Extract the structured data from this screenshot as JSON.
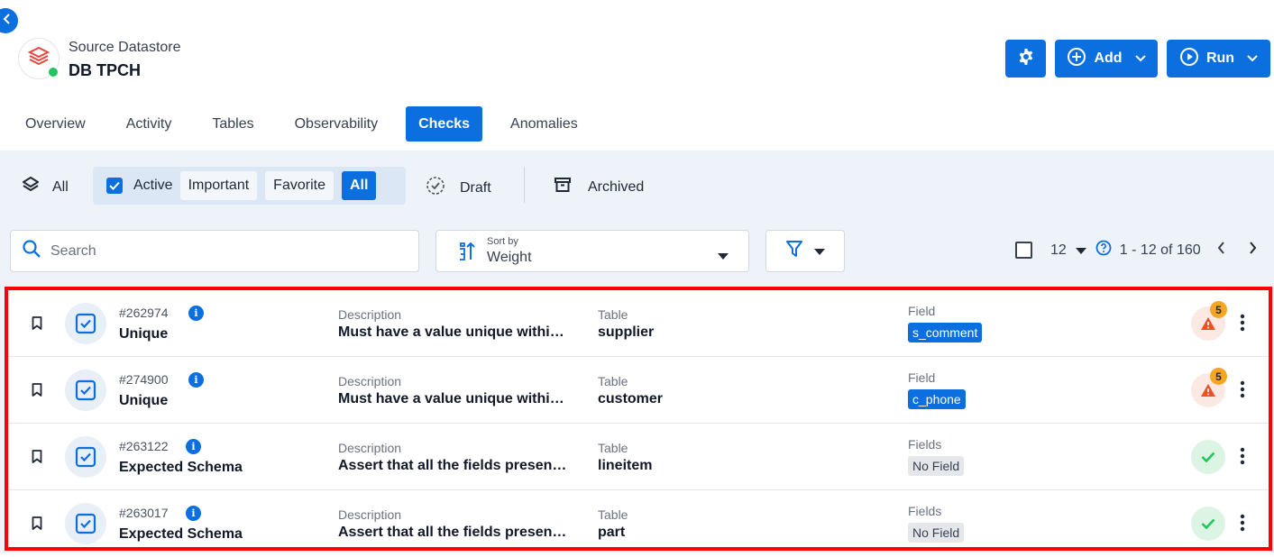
{
  "header": {
    "datastore_caption": "Source Datastore",
    "datastore_name": "DB TPCH",
    "add_label": "Add",
    "run_label": "Run"
  },
  "tabs": [
    {
      "label": "Overview"
    },
    {
      "label": "Activity"
    },
    {
      "label": "Tables"
    },
    {
      "label": "Observability"
    },
    {
      "label": "Checks",
      "active": true
    },
    {
      "label": "Anomalies"
    }
  ],
  "status_filter": {
    "all_label": "All",
    "active_label": "Active",
    "important_label": "Important",
    "favorite_label": "Favorite",
    "active_all_label": "All",
    "draft_label": "Draft",
    "archived_label": "Archived"
  },
  "search": {
    "placeholder": "Search"
  },
  "sort": {
    "caption": "Sort by",
    "value": "Weight"
  },
  "pagination": {
    "per_page": "12",
    "range": "1 - 12 of 160"
  },
  "checks": [
    {
      "id": "#262974",
      "name": "Unique",
      "description_label": "Description",
      "description": "Must have a value unique within the table",
      "table_label": "Table",
      "table": "supplier",
      "field_label": "Field",
      "field": "s_comment",
      "status": "warning",
      "anomaly_count": "5"
    },
    {
      "id": "#274900",
      "name": "Unique",
      "description_label": "Description",
      "description": "Must have a value unique within the table",
      "table_label": "Table",
      "table": "customer",
      "field_label": "Field",
      "field": "c_phone",
      "status": "warning",
      "anomaly_count": "5"
    },
    {
      "id": "#263122",
      "name": "Expected Schema",
      "description_label": "Description",
      "description": "Assert that all the fields present in the schema",
      "table_label": "Table",
      "table": "lineitem",
      "field_label": "Fields",
      "field": "No Field",
      "status": "passed"
    },
    {
      "id": "#263017",
      "name": "Expected Schema",
      "description_label": "Description",
      "description": "Assert that all the fields present in the schema",
      "table_label": "Table",
      "table": "part",
      "field_label": "Fields",
      "field": "No Field",
      "status": "passed"
    }
  ],
  "colors": {
    "accent": "#0b6fe0",
    "warning": "#f04e23",
    "badge": "#f5a623",
    "success": "#22c55e",
    "highlight_border": "#ff0000"
  }
}
